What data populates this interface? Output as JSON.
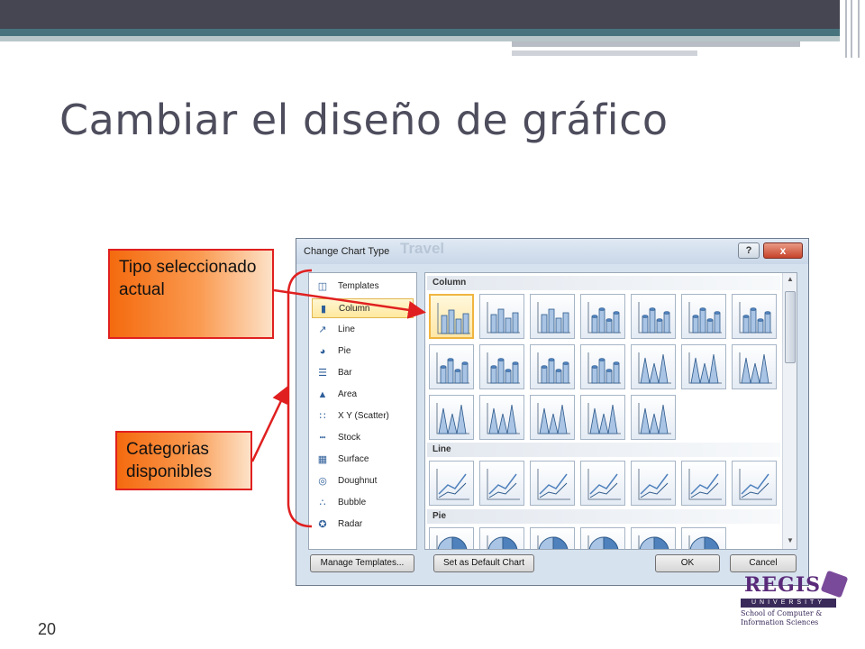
{
  "slide": {
    "title": "Cambiar el diseño de gráfico",
    "page_number": "20"
  },
  "callouts": {
    "current_type": "Tipo seleccionado actual",
    "categories": "Categorias disponibles"
  },
  "dialog": {
    "title": "Change Chart Type",
    "faded_background_text": "Travel",
    "help_label": "?",
    "close_label": "x",
    "categories": [
      {
        "label": "Templates",
        "icon": "folder-icon"
      },
      {
        "label": "Column",
        "icon": "column-chart-icon",
        "selected": true
      },
      {
        "label": "Line",
        "icon": "line-chart-icon"
      },
      {
        "label": "Pie",
        "icon": "pie-chart-icon"
      },
      {
        "label": "Bar",
        "icon": "bar-chart-icon"
      },
      {
        "label": "Area",
        "icon": "area-chart-icon"
      },
      {
        "label": "X Y (Scatter)",
        "icon": "scatter-chart-icon"
      },
      {
        "label": "Stock",
        "icon": "stock-chart-icon"
      },
      {
        "label": "Surface",
        "icon": "surface-chart-icon"
      },
      {
        "label": "Doughnut",
        "icon": "doughnut-chart-icon"
      },
      {
        "label": "Bubble",
        "icon": "bubble-chart-icon"
      },
      {
        "label": "Radar",
        "icon": "radar-chart-icon"
      }
    ],
    "sections": {
      "column": "Column",
      "line": "Line",
      "pie": "Pie"
    },
    "buttons": {
      "manage_templates": "Manage Templates...",
      "set_default": "Set as Default Chart",
      "ok": "OK",
      "cancel": "Cancel"
    }
  },
  "logo": {
    "name": "REGIS",
    "university": "UNIVERSITY",
    "school": "School of Computer & Information Sciences"
  },
  "colors": {
    "callout_fill": "#f46a0e",
    "callout_border": "#e02020",
    "arrow": "#e02020",
    "header_bar": "#464653",
    "teal_band": "#46737d"
  }
}
